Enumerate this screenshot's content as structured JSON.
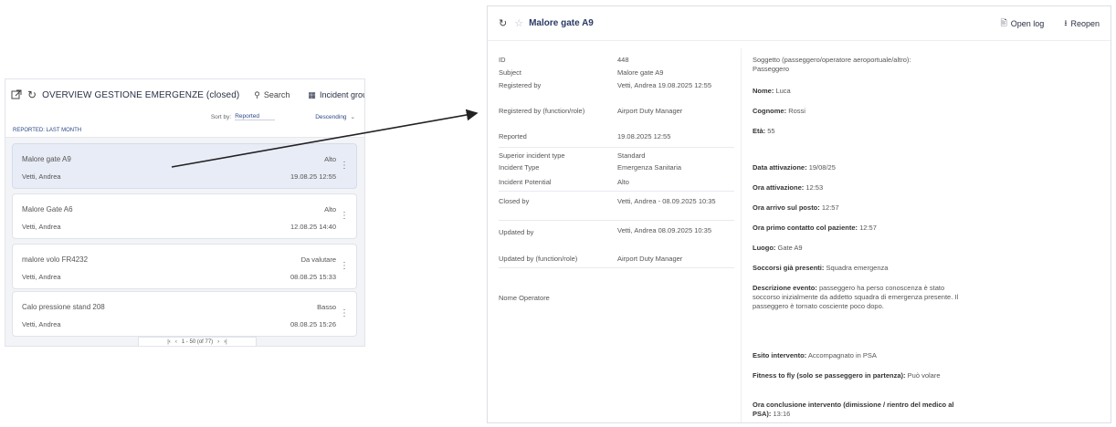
{
  "list": {
    "title": "OVERVIEW GESTIONE EMERGENZE (closed)",
    "search_label": "Search",
    "group_label": "Incident group",
    "sort_label": "Sort by:",
    "sort_value": "Reported",
    "sort_direction": "Descending",
    "sublabel": "REPORTED: LAST MONTH",
    "items": [
      {
        "title": "Malore gate A9",
        "name": "Vetti, Andrea",
        "priority": "Alto",
        "date": "19.08.25 12:55"
      },
      {
        "title": "Malore Gate A6",
        "name": "Vetti, Andrea",
        "priority": "Alto",
        "date": "12.08.25 14:40"
      },
      {
        "title": "malore volo FR4232",
        "name": "Vetti, Andrea",
        "priority": "Da valutare",
        "date": "08.08.25 15:33"
      },
      {
        "title": "Calo pressione stand 208",
        "name": "Vetti, Andrea",
        "priority": "Basso",
        "date": "08.08.25 15:26"
      }
    ],
    "pager": "1 - 50 (of 77)"
  },
  "detail": {
    "title": "Malore gate A9",
    "open_log": "Open log",
    "reopen": "Reopen",
    "fields": [
      {
        "label": "ID",
        "value": "448"
      },
      {
        "label": "Subject",
        "value": "Malore gate A9"
      },
      {
        "label": "Registered by",
        "value": "Vetti, Andrea 19.08.2025 12:55"
      },
      {
        "label": "Registered by (function/role)",
        "value": "Airport Duty Manager"
      },
      {
        "label": "Reported",
        "value": "19.08.2025 12:55"
      },
      {
        "label": "Superior incident type",
        "value": "Standard"
      },
      {
        "label": "Incident Type",
        "value": "Emergenza Sanitaria"
      },
      {
        "label": "Incident Potential",
        "value": "Alto"
      },
      {
        "label": "Closed by",
        "value": "Vetti, Andrea - 08.09.2025 10:35"
      },
      {
        "label": "Updated by",
        "value": "Vetti, Andrea 08.09.2025 10:35"
      },
      {
        "label": "Updated by (function/role)",
        "value": "Airport Duty Manager"
      },
      {
        "label": "Nome Operatore",
        "value": ""
      }
    ],
    "notes": [
      {
        "k": "Soggetto (passeggero/operatore aeroportuale/altro):",
        "v": "Passeggero",
        "bold": false
      },
      {
        "k": "Nome:",
        "v": "Luca",
        "bold": true
      },
      {
        "k": "Cognome:",
        "v": "Rossi",
        "bold": true
      },
      {
        "k": "Età:",
        "v": "55",
        "bold": true
      },
      {
        "k": "Data attivazione:",
        "v": "19/08/25",
        "bold": true
      },
      {
        "k": "Ora attivazione:",
        "v": "12:53",
        "bold": true
      },
      {
        "k": "Ora arrivo sul posto:",
        "v": "12:57",
        "bold": true
      },
      {
        "k": "Ora primo contatto col paziente:",
        "v": "12:57",
        "bold": true
      },
      {
        "k": "Luogo:",
        "v": "Gate A9",
        "bold": true
      },
      {
        "k": "Soccorsi già presenti:",
        "v": "Squadra emergenza",
        "bold": true
      },
      {
        "k": "Descrizione evento:",
        "v": "passeggero ha perso conoscenza è stato soccorso inizialmente da addetto squadra di emergenza presente. Il passeggero è tornato cosciente poco dopo.",
        "bold": true
      },
      {
        "k": "Esito intervento:",
        "v": "Accompagnato in PSA",
        "bold": true
      },
      {
        "k": "Fitness to fly (solo se passeggero in partenza):",
        "v": "Può volare",
        "bold": true
      },
      {
        "k": "Ora conclusione intervento (dimissione / rientro del medico al PSA):",
        "v": "13:16",
        "bold": true
      }
    ]
  }
}
